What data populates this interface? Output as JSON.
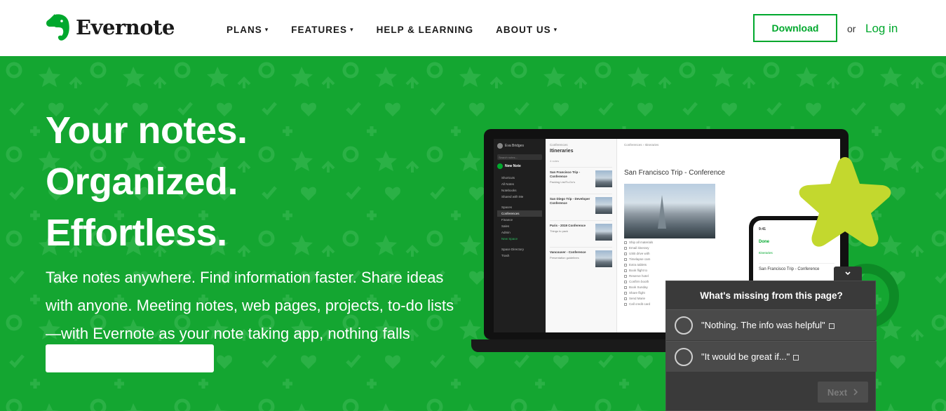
{
  "header": {
    "brand": "Evernote",
    "nav": [
      {
        "label": "PLANS",
        "caret": "▾"
      },
      {
        "label": "FEATURES",
        "caret": "▾"
      },
      {
        "label": "HELP & LEARNING",
        "caret": ""
      },
      {
        "label": "ABOUT US",
        "caret": "▾"
      }
    ],
    "download_label": "Download",
    "or_text": "or",
    "login_label": "Log in"
  },
  "hero": {
    "headline": [
      "Your notes.",
      "Organized.",
      "Effortless."
    ],
    "subtext": "Take notes anywhere. Find information faster. Share ideas with anyone. Meeting notes, web pages, projects, to-do lists—with Evernote as your note taking app, nothing falls through the cracks.",
    "colors": {
      "background": "#14a631",
      "accent": "#00a82d",
      "star": "#c3d82e"
    }
  },
  "app_mock": {
    "sidebar": {
      "user": "Eva Bridges",
      "search": "Search notes...",
      "new_note": "New Note",
      "items": [
        "Shortcuts",
        "All Notes",
        "Notebooks",
        "Shared with Me"
      ],
      "spaces_label": "Spaces",
      "spaces": [
        "Conferences",
        "Finance",
        "Sales",
        "Admin",
        "New Space"
      ],
      "footer": [
        "Space Directory",
        "Trash"
      ]
    },
    "list": {
      "crumb": "Conferences",
      "title": "Itineraries",
      "count": "4 notes",
      "notes": [
        {
          "title": "San Francisco Trip - Conference",
          "sub": "Packing List/To-Do's"
        },
        {
          "title": "San Diego Trip - Developer Conference",
          "sub": ""
        },
        {
          "title": "Paris - 2019 Conference",
          "sub": "Things to pack"
        },
        {
          "title": "Vancouver - Conference",
          "sub": "Presentation guidelines"
        }
      ]
    },
    "editor": {
      "crumb": "Conferences › Itineraries",
      "title": "San Francisco Trip - Conference",
      "checklist": [
        "Ship all materials",
        "Email itinerary",
        "USB drive with",
        "Timelapse cam",
        "Extra tablets",
        "Book flight to",
        "Reserve hotel",
        "Confirm booth",
        "Book Sunday",
        "Share flight",
        "Send Marie",
        "Call credit card"
      ]
    },
    "phone": {
      "time": "9:41",
      "done": "Done",
      "tag": "Itineraries",
      "title": "San Francisco Trip - Conference"
    }
  },
  "feedback": {
    "question": "What's missing from this page?",
    "options": [
      "\"Nothing. The info was helpful\"",
      "\"It would be great if...\""
    ],
    "next_label": "Next"
  }
}
